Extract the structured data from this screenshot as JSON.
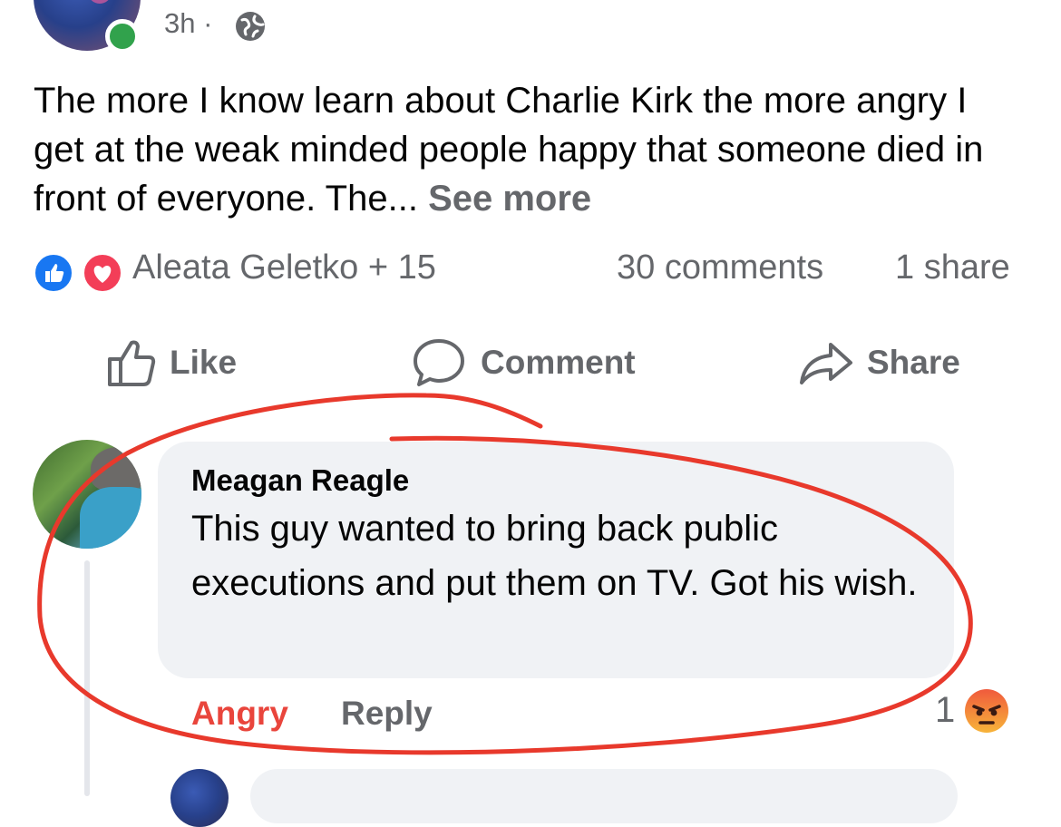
{
  "post": {
    "time": "3h",
    "separator": "·",
    "privacy_icon": "globe-icon",
    "text": "The more I know learn about Charlie Kirk the more angry I get at the weak minded people happy that someone died in front of everyone. The...",
    "see_more": "See more"
  },
  "reactions": {
    "icons": [
      "like-reaction-icon",
      "love-reaction-icon"
    ],
    "summary": "Aleata Geletko + 15",
    "comments": "30 comments",
    "shares": "1 share"
  },
  "actions": {
    "like": "Like",
    "comment": "Comment",
    "share": "Share"
  },
  "comment": {
    "author": "Meagan Reagle",
    "text": "This guy wanted to bring back public executions and put them on TV. Got his wish.",
    "reaction_label": "Angry",
    "reply_label": "Reply",
    "reaction_count": "1",
    "reaction_icon": "angry-emoji-icon"
  },
  "colors": {
    "facebook_blue": "#1877f2",
    "love_red": "#f33e58",
    "angry_red": "#e9453c",
    "annotation_red": "#e8392c",
    "secondary_text": "#65676b",
    "bubble_bg": "#f0f2f5",
    "online_green": "#31a24c"
  }
}
